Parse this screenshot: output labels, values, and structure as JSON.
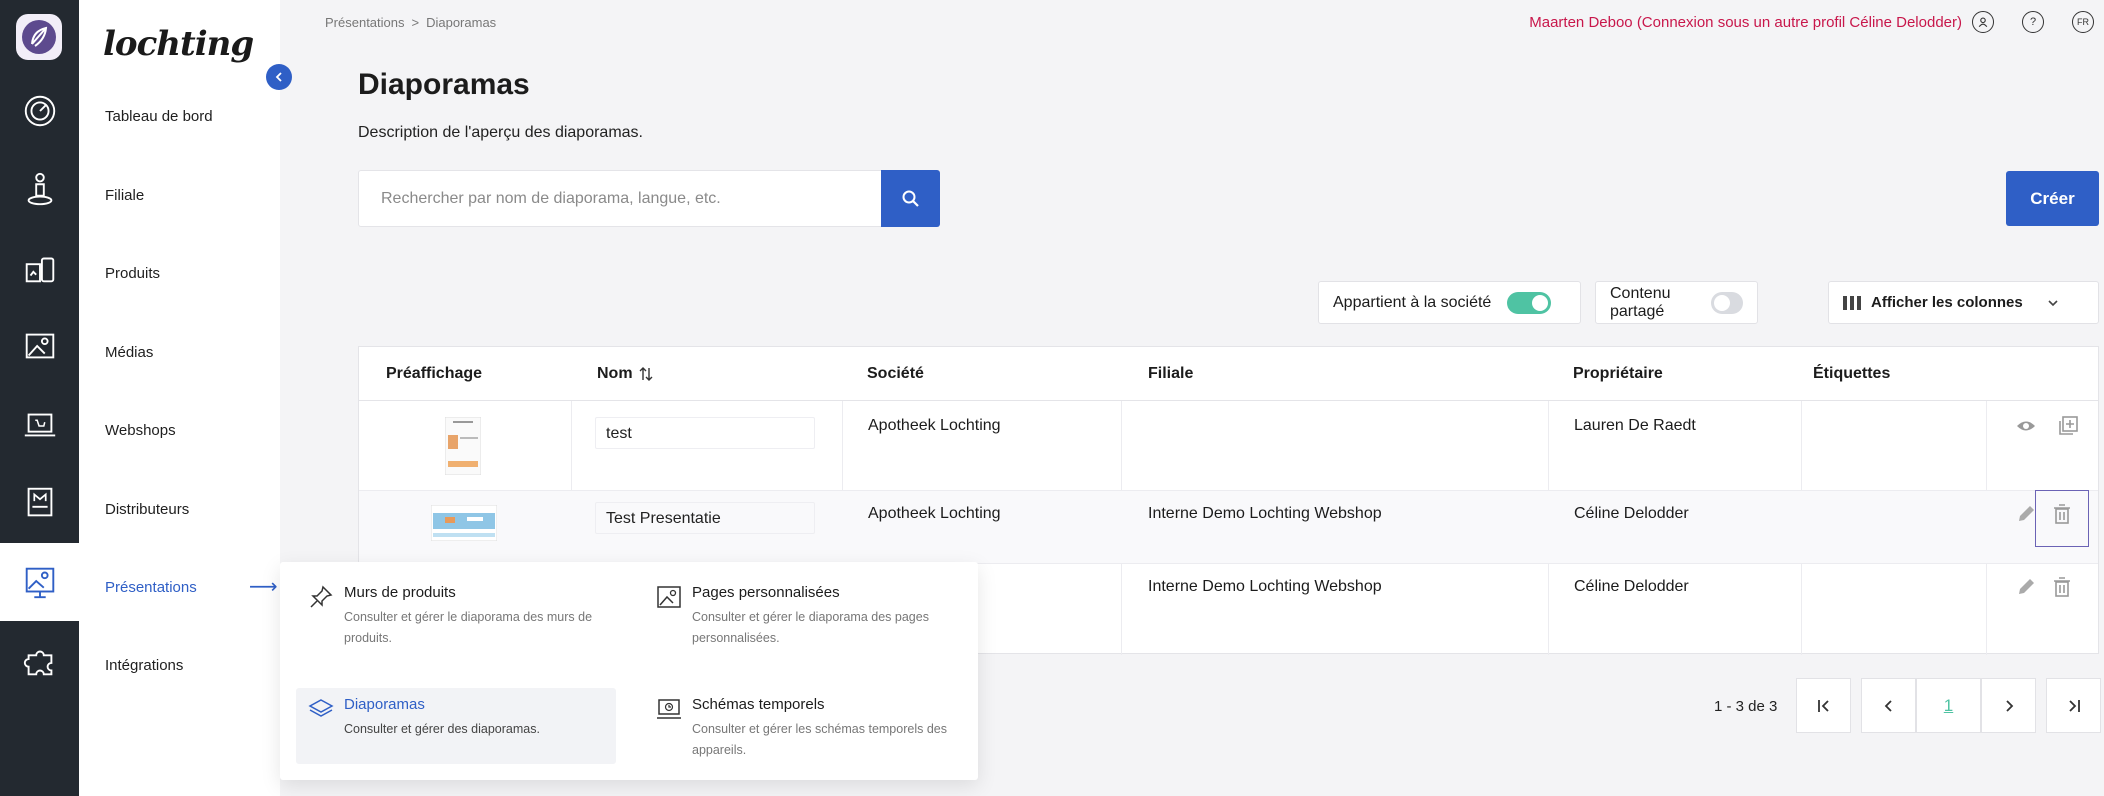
{
  "brand": "lochting",
  "sidebar": {
    "items": [
      {
        "label": "Tableau de bord"
      },
      {
        "label": "Filiale"
      },
      {
        "label": "Produits"
      },
      {
        "label": "Médias"
      },
      {
        "label": "Webshops"
      },
      {
        "label": "Distributeurs"
      },
      {
        "label": "Présentations"
      },
      {
        "label": "Intégrations"
      }
    ],
    "arrow": "⟶"
  },
  "breadcrumb": {
    "parent": "Présentations",
    "separator": ">",
    "current": "Diaporamas"
  },
  "user": {
    "text": "Maarten Deboo (Connexion sous un autre profil Céline Delodder)",
    "lang": "FR",
    "help": "?"
  },
  "page": {
    "title": "Diaporamas",
    "description": "Description de l'aperçu des diaporamas."
  },
  "search": {
    "placeholder": "Rechercher par nom de diaporama, langue, etc.",
    "value": ""
  },
  "create_label": "Créer",
  "filters": {
    "company": {
      "label": "Appartient à la société",
      "on": true
    },
    "shared": {
      "label": "Contenu partagé",
      "on": false
    },
    "columns_label": "Afficher les colonnes"
  },
  "table": {
    "headers": [
      "Préaffichage",
      "Nom",
      "Société",
      "Filiale",
      "Propriétaire",
      "Étiquettes"
    ],
    "rows": [
      {
        "name": "test",
        "company": "Apotheek Lochting",
        "branch": "",
        "owner": "Lauren De Raedt",
        "tags": ""
      },
      {
        "name": "Test Presentatie",
        "company": "Apotheek Lochting",
        "branch": "Interne Demo Lochting Webshop",
        "owner": "Céline Delodder",
        "tags": ""
      },
      {
        "name": "",
        "company": "nting",
        "branch": "Interne Demo Lochting Webshop",
        "owner": "Céline Delodder",
        "tags": ""
      }
    ]
  },
  "pagination": {
    "range": "1 - 3 de 3",
    "current": "1"
  },
  "flyout": {
    "items": [
      {
        "title": "Murs de produits",
        "desc": "Consulter et gérer le diaporama des murs de produits."
      },
      {
        "title": "Pages personnalisées",
        "desc": "Consulter et gérer le diaporama des pages personnalisées."
      },
      {
        "title": "Diaporamas",
        "desc": "Consulter et gérer des diaporamas."
      },
      {
        "title": "Schémas temporels",
        "desc": "Consulter et gérer les schémas temporels des appareils."
      }
    ]
  },
  "colors": {
    "accent": "#2f5fc6",
    "rail": "#232930",
    "toggle_on": "#4fc3a3",
    "user_text": "#c8174b"
  }
}
